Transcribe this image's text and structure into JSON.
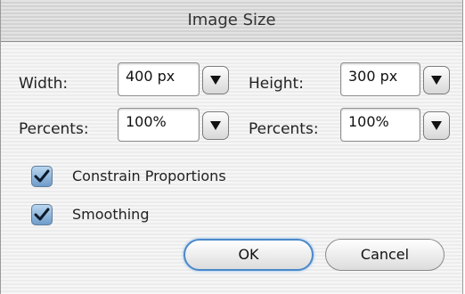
{
  "dialog": {
    "title": "Image Size"
  },
  "size": {
    "width_label": "Width:",
    "width_value": "400 px",
    "height_label": "Height:",
    "height_value": "300 px",
    "width_percent_label": "Percents:",
    "width_percent_value": "100%",
    "height_percent_label": "Percents:",
    "height_percent_value": "100%"
  },
  "options": {
    "constrain_label": "Constrain Proportions",
    "constrain_checked": true,
    "smoothing_label": "Smoothing",
    "smoothing_checked": true
  },
  "buttons": {
    "ok_label": "OK",
    "cancel_label": "Cancel"
  },
  "icons": {
    "dropdown": "chevron-down-icon",
    "check": "checkmark-icon"
  },
  "colors": {
    "accent": "#4a88c9",
    "checkbox": "#6e9ccb"
  }
}
